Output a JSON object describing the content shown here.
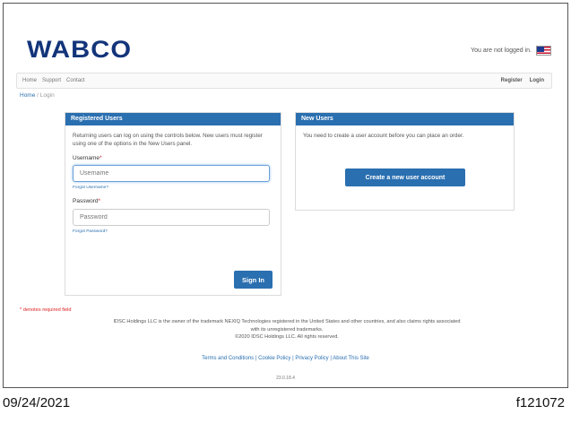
{
  "header": {
    "logo": "WABCO",
    "login_status": "You are not logged in.",
    "flag_icon": "us-flag-icon"
  },
  "nav": {
    "left": [
      "Home",
      "Support",
      "Contact"
    ],
    "right": [
      "Register",
      "Login"
    ]
  },
  "breadcrumb": {
    "home": "Home",
    "separator": "/",
    "current": "Login"
  },
  "registered": {
    "title": "Registered Users",
    "intro": "Returning users can log on using the controls below. New users must register using one of the options in the New Users panel.",
    "username_label": "Username",
    "username_placeholder": "Username",
    "forgot_username": "Forgot Username?",
    "password_label": "Password",
    "password_placeholder": "Password",
    "forgot_password": "Forgot Password?",
    "sign_in": "Sign In",
    "required_mark": "*"
  },
  "new_users": {
    "title": "New Users",
    "intro": "You need to create a user account before you can place an order.",
    "create_button": "Create a new user account"
  },
  "footer": {
    "required_note": "* denotes required field",
    "trademark_line1": "IDSC Holdings LLC is the owner of the trademark NEXIQ Technologies registered in the United States and other countries, and also claims rights associated",
    "trademark_line2": "with its unregistered trademarks.",
    "copyright": "©2020 IDSC Holdings LLC. All rights reserved.",
    "links": [
      "Terms and Conditions",
      "Cookie Policy",
      "Privacy Policy",
      "About This Site"
    ],
    "link_separator": "|",
    "version": "23.0.18.4"
  },
  "caption": {
    "date": "09/24/2021",
    "code": "f121072"
  },
  "colors": {
    "brand": "#13347a",
    "accent": "#2a6fb0",
    "required": "#d22222"
  }
}
